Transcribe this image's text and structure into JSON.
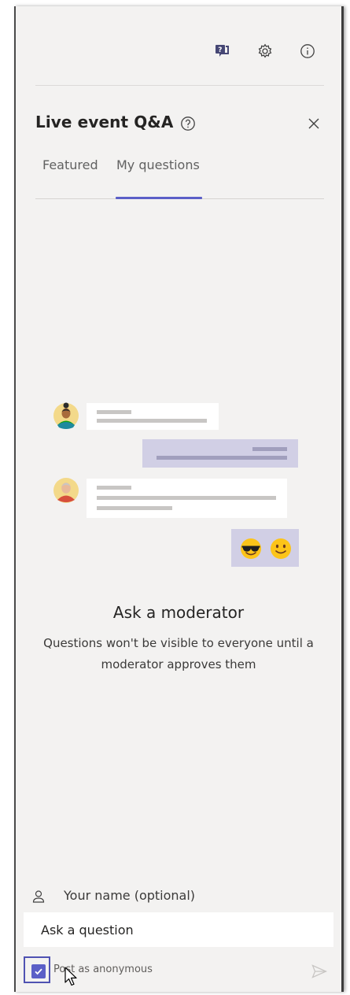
{
  "toolbar": {
    "icons": [
      "qna-icon",
      "gear-icon",
      "info-icon"
    ]
  },
  "header": {
    "title": "Live event Q&A",
    "help_icon": "help-circle-icon",
    "close_icon": "close-icon"
  },
  "tabs": [
    {
      "label": "Featured",
      "active": false
    },
    {
      "label": "My questions",
      "active": true
    }
  ],
  "empty_state": {
    "title": "Ask a moderator",
    "description": "Questions won't be visible to everyone until a moderator approves them",
    "emojis": [
      "😎",
      "🙂"
    ]
  },
  "compose": {
    "name_placeholder": "Your name (optional)",
    "question_placeholder": "Ask a question",
    "anonymous_label": "Post as anonymous",
    "anonymous_checked": true
  },
  "colors": {
    "accent": "#5b5fc7",
    "panel_bg": "#f3f2f1",
    "bubble_purple": "#d1cfe5"
  }
}
